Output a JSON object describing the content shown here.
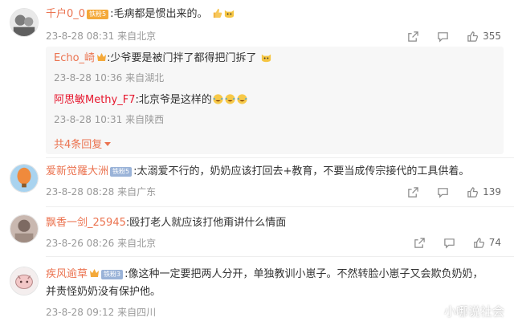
{
  "comments": [
    {
      "user": "千户0_0",
      "badge": "铁粉5",
      "text": ":毛病都是惯出来的。",
      "time": "23-8-28 08:31",
      "location": "来自北京",
      "likes": "355",
      "replies": [
        {
          "user": "Echo_崎",
          "text": ":少爷要是被门拌了都得把门拆了",
          "time": "23-8-28 10:36",
          "location": "来自湖北"
        },
        {
          "user": "阿思敏Methy_F7",
          "text": ":北京爷是这样的",
          "time": "23-8-28 10:31",
          "location": "来自陕西"
        }
      ],
      "more_replies": "共4条回复"
    },
    {
      "user": "爱新觉羅大洲",
      "badge": "铁粉5",
      "text": ":太溺爱不行的，奶奶应该打回去+教育，不要当成传宗接代的工具供着。",
      "time": "23-8-28 08:28",
      "location": "来自广东",
      "likes": "139"
    },
    {
      "user": "飘香一剑_25945",
      "text": ":殴打老人就应该打他甭讲什么情面",
      "time": "23-8-26 08:26",
      "location": "来自北京",
      "likes": "74"
    },
    {
      "user": "疾风逾草",
      "badge": "铁粉3",
      "text_line1": ":像这种一定要把两人分开，单独教训小崽子。不然转脸小崽子又会欺负奶奶，",
      "text_line2": "并责怪奶奶没有保护他。",
      "time": "23-8-28 09:12",
      "location": "来自四川"
    }
  ],
  "watermark": "小哪说社会",
  "colors": {
    "username": "#eb7350",
    "reply_username": "#e6162d",
    "meta": "#999999",
    "reply_bg": "#f7f7f7"
  }
}
